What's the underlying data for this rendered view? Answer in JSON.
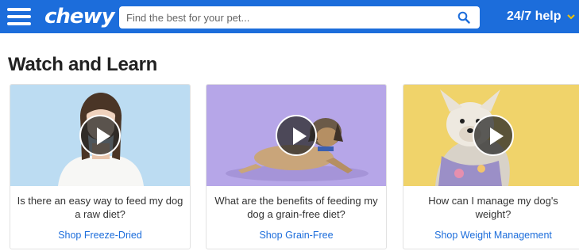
{
  "header": {
    "logo": "chewy",
    "search_placeholder": "Find the best for your pet...",
    "help_label": "24/7 help",
    "brand_color": "#1c6ddb"
  },
  "section": {
    "title": "Watch and Learn"
  },
  "cards": [
    {
      "question": "Is there an easy way to feed my dog a raw diet?",
      "link": "Shop Freeze-Dried"
    },
    {
      "question": "What are the benefits of feeding my dog a grain-free diet?",
      "link": "Shop Grain-Free"
    },
    {
      "question": "How can I manage my dog's weight?",
      "link": "Shop Weight Management"
    }
  ]
}
